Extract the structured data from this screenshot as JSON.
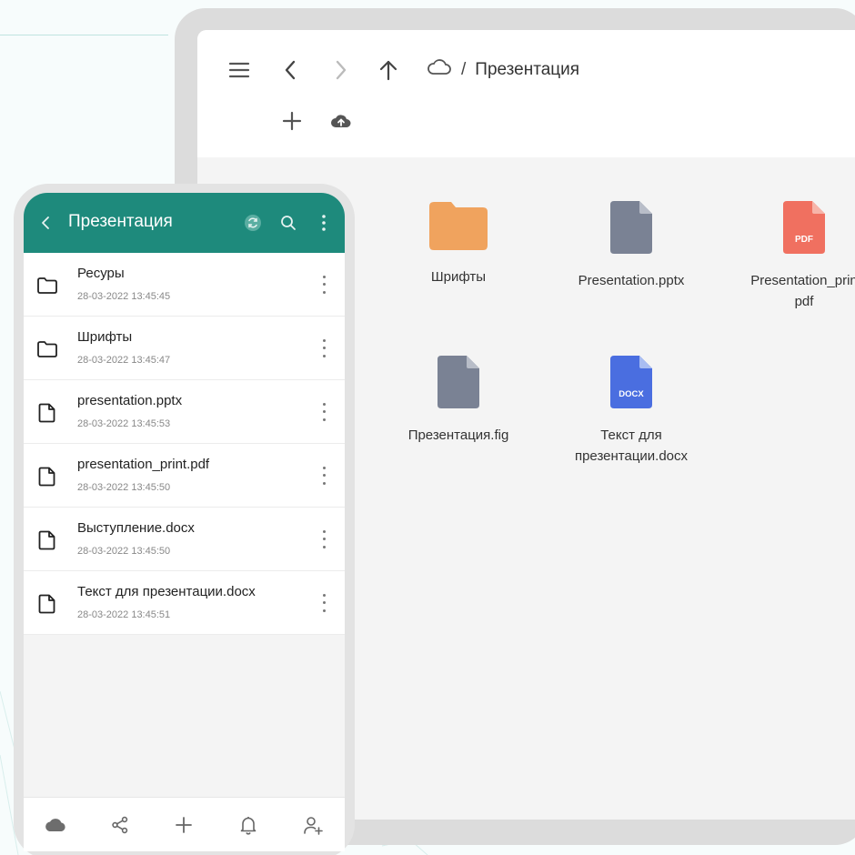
{
  "desktop": {
    "breadcrumb": {
      "current": "Презентация",
      "separator": "/"
    },
    "items": [
      {
        "label": "Шрифты",
        "type": "folder",
        "icon": "folder-icon"
      },
      {
        "label": "Presentation.pptx",
        "type": "file",
        "icon": "file-icon"
      },
      {
        "label": "Presentation_prin pdf",
        "line1": "Presentation_prin",
        "line2": "pdf",
        "type": "pdf",
        "icon": "pdf-file-icon",
        "badge": "PDF"
      },
      {
        "label": "Презентация.fig",
        "type": "file",
        "icon": "file-icon"
      },
      {
        "label": "Текст для презентации.docx",
        "line1": "Текст для",
        "line2": "презентации.docx",
        "type": "docx",
        "icon": "docx-file-icon",
        "badge": "DOCX"
      }
    ]
  },
  "phone": {
    "title": "Презентация",
    "files": [
      {
        "name": "Ресуры",
        "date": "28-03-2022 13:45:45",
        "type": "folder"
      },
      {
        "name": "Шрифты",
        "date": "28-03-2022 13:45:47",
        "type": "folder"
      },
      {
        "name": "presentation.pptx",
        "date": "28-03-2022 13:45:53",
        "type": "file"
      },
      {
        "name": "presentation_print.pdf",
        "date": "28-03-2022 13:45:50",
        "type": "file"
      },
      {
        "name": "Выступление.docx",
        "date": "28-03-2022 13:45:50",
        "type": "file"
      },
      {
        "name": "Текст для презентации.docx",
        "date": "28-03-2022 13:45:51",
        "type": "file"
      }
    ],
    "bottom_nav": [
      "cloud-icon",
      "share-icon",
      "plus-icon",
      "bell-icon",
      "add-user-icon"
    ]
  },
  "colors": {
    "phone_header": "#1e8a7c",
    "folder": "#f0a35e",
    "file_gray": "#7a8294",
    "pdf_red": "#f07060",
    "docx_blue": "#4a6ee0"
  }
}
